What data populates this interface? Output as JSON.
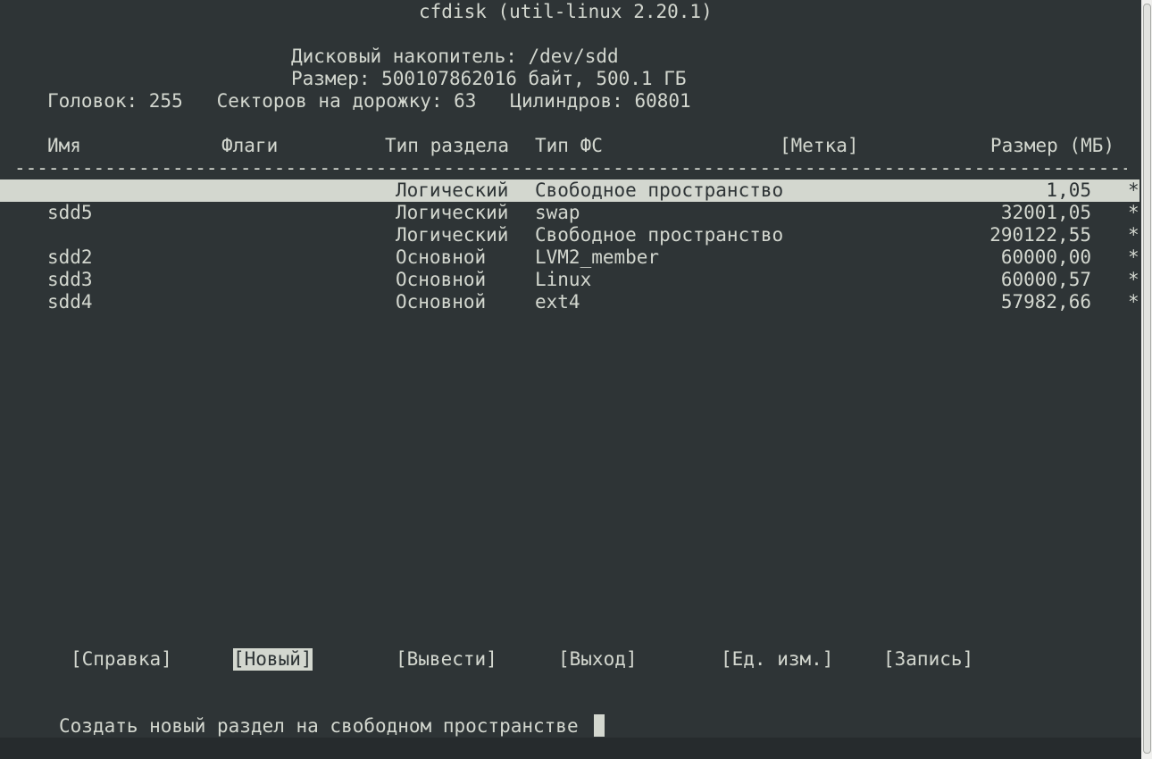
{
  "title": "cfdisk (util-linux 2.20.1)",
  "disk": {
    "drive_line": "Дисковый накопитель: /dev/sdd",
    "size_line": "Размер: 500107862016 байт, 500.1 ГБ",
    "geometry_line": "Головок: 255   Секторов на дорожку: 63   Цилиндров: 60801"
  },
  "table": {
    "headers": {
      "name": "Имя",
      "flags": "Флаги",
      "part_type": "Тип раздела",
      "fs_type": "Тип ФС",
      "label": "[Метка]",
      "size": "Размер (МБ)"
    },
    "separator": "----------------------------------------------------------------------------------------------------------",
    "rows": [
      {
        "name": "",
        "flags": "",
        "part_type": "Логический",
        "fs_type": "Свободное пространство",
        "label": "",
        "size": "1,05",
        "mark": "*",
        "selected": true
      },
      {
        "name": "sdd5",
        "flags": "",
        "part_type": "Логический",
        "fs_type": "swap",
        "label": "",
        "size": "32001,05",
        "mark": "*",
        "selected": false
      },
      {
        "name": "",
        "flags": "",
        "part_type": "Логический",
        "fs_type": "Свободное пространство",
        "label": "",
        "size": "290122,55",
        "mark": "*",
        "selected": false
      },
      {
        "name": "sdd2",
        "flags": "",
        "part_type": "Основной",
        "fs_type": "LVM2_member",
        "label": "",
        "size": "60000,00",
        "mark": "*",
        "selected": false
      },
      {
        "name": "sdd3",
        "flags": "",
        "part_type": "Основной",
        "fs_type": "Linux",
        "label": "",
        "size": "60000,57",
        "mark": "*",
        "selected": false
      },
      {
        "name": "sdd4",
        "flags": "",
        "part_type": "Основной",
        "fs_type": "ext4",
        "label": "",
        "size": "57982,66",
        "mark": "*",
        "selected": false
      }
    ]
  },
  "menu": {
    "help": "[Справка]",
    "new": "[Новый]",
    "print": "[Вывести]",
    "quit": "[Выход]",
    "units": "[Ед. изм.]",
    "write": "[Запись]",
    "active": "new"
  },
  "status": {
    "text": "Создать новый раздел на свободном пространстве"
  },
  "colors": {
    "background": "#2e3436",
    "foreground": "#d3d7cf",
    "highlight": "#d3d7cf"
  }
}
